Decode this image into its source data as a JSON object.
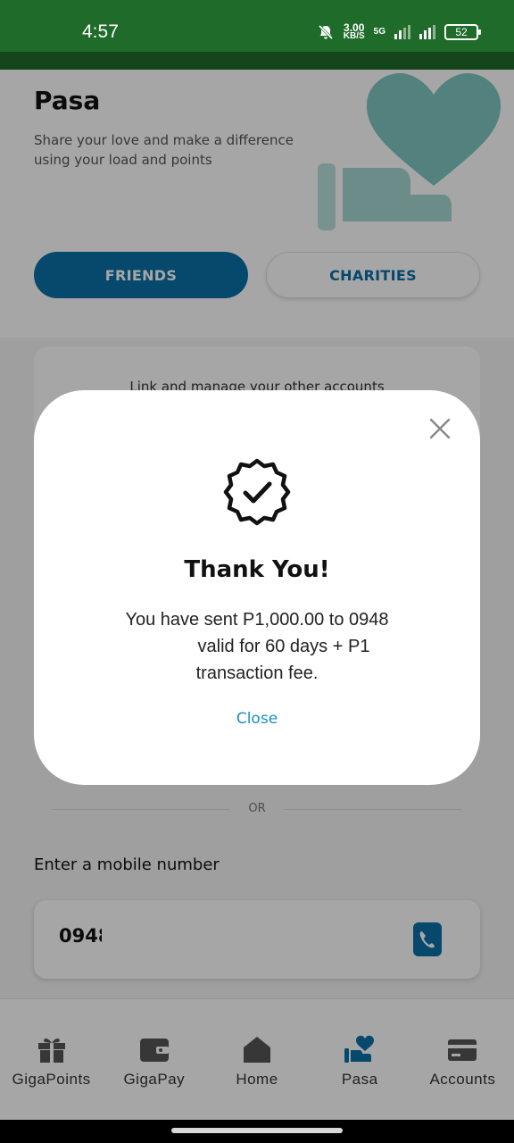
{
  "status_bar": {
    "time": "4:57",
    "speed_value": "3.00",
    "speed_unit": "KB/S",
    "network": "5G",
    "battery": "52"
  },
  "header": {
    "title": "Pasa",
    "subtitle": "Share your love and make a difference using your load and points"
  },
  "tabs": [
    {
      "label": "FRIENDS",
      "active": true
    },
    {
      "label": "CHARITIES",
      "active": false
    }
  ],
  "link_card": {
    "text": "Link and manage your other accounts"
  },
  "divider": {
    "label": "OR"
  },
  "mobile_input": {
    "label": "Enter a mobile number",
    "value": "0948"
  },
  "bottom_nav": [
    {
      "label": "GigaPoints",
      "icon": "gift-icon"
    },
    {
      "label": "GigaPay",
      "icon": "wallet-icon"
    },
    {
      "label": "Home",
      "icon": "home-icon"
    },
    {
      "label": "Pasa",
      "icon": "share-heart-icon",
      "active": true
    },
    {
      "label": "Accounts",
      "icon": "card-icon"
    }
  ],
  "modal": {
    "title": "Thank You!",
    "message_line1": "You have sent P1,000.00 to 0948",
    "message_line2": "valid for 60 days + P1",
    "message_line3": "transaction fee.",
    "close_label": "Close"
  },
  "colors": {
    "status_bar": "#1f6b2a",
    "brand_blue": "#0b6fa8",
    "link_blue": "#1b8fc0",
    "heart_teal": "#7fc7c2"
  }
}
